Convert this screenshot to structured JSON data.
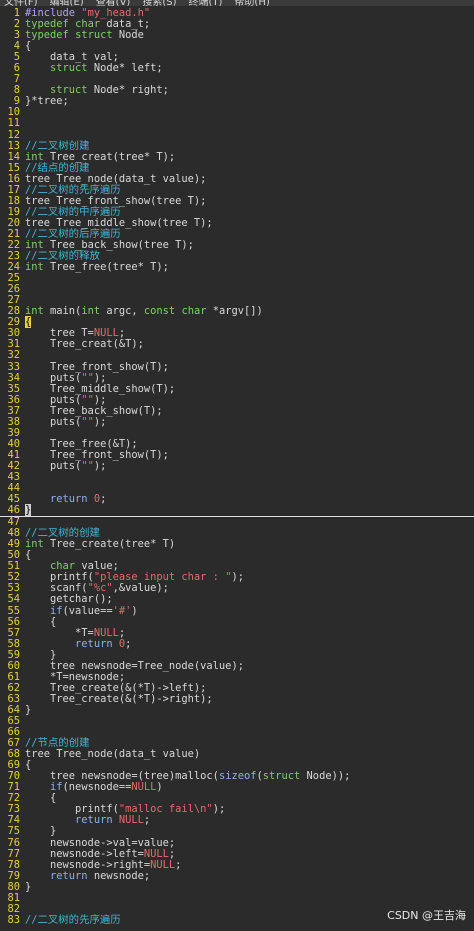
{
  "menu": [
    "文件(F)",
    "编辑(E)",
    "查看(V)",
    "搜索(S)",
    "终端(T)",
    "帮助(H)"
  ],
  "watermark": "CSDN @王吉海",
  "lines": [
    {
      "n": "1",
      "t": "#include \"my_head.h\"",
      "k": "pp"
    },
    {
      "n": "2",
      "t": "typedef char data_t;",
      "k": "ty"
    },
    {
      "n": "3",
      "t": "typedef struct Node",
      "k": "ty"
    },
    {
      "n": "4",
      "t": "{",
      "k": ""
    },
    {
      "n": "5",
      "t": "    data_t val;",
      "k": ""
    },
    {
      "n": "6",
      "t": "    struct Node* left;",
      "k": ""
    },
    {
      "n": "7",
      "t": "",
      "k": ""
    },
    {
      "n": "8",
      "t": "    struct Node* right;",
      "k": ""
    },
    {
      "n": "9",
      "t": "}*tree;",
      "k": ""
    },
    {
      "n": "10",
      "t": "",
      "k": ""
    },
    {
      "n": "11",
      "t": "",
      "k": ""
    },
    {
      "n": "12",
      "t": "",
      "k": ""
    },
    {
      "n": "13",
      "t": "//二叉树创建",
      "k": "cmt"
    },
    {
      "n": "14",
      "t": "int Tree_creat(tree* T);",
      "k": ""
    },
    {
      "n": "15",
      "t": "//结点的创建",
      "k": "cmt"
    },
    {
      "n": "16",
      "t": "tree Tree_node(data_t value);",
      "k": ""
    },
    {
      "n": "17",
      "t": "//二叉树的先序遍历",
      "k": "cmt"
    },
    {
      "n": "18",
      "t": "tree Tree_front_show(tree T);",
      "k": ""
    },
    {
      "n": "19",
      "t": "//二叉树的中序遍历",
      "k": "cmt"
    },
    {
      "n": "20",
      "t": "tree Tree_middle_show(tree T);",
      "k": ""
    },
    {
      "n": "21",
      "t": "//二叉树的后序遍历",
      "k": "cmt"
    },
    {
      "n": "22",
      "t": "int Tree_back_show(tree T);",
      "k": ""
    },
    {
      "n": "23",
      "t": "//二叉树的释放",
      "k": "cmt"
    },
    {
      "n": "24",
      "t": "int Tree_free(tree* T);",
      "k": ""
    },
    {
      "n": "25",
      "t": "",
      "k": ""
    },
    {
      "n": "26",
      "t": "",
      "k": ""
    },
    {
      "n": "27",
      "t": "",
      "k": ""
    },
    {
      "n": "28",
      "t": "int main(int argc, const char *argv[])",
      "k": ""
    },
    {
      "n": "29",
      "t": "{",
      "k": "cur"
    },
    {
      "n": "30",
      "t": "    tree T=NULL;",
      "k": ""
    },
    {
      "n": "31",
      "t": "    Tree_creat(&T);",
      "k": ""
    },
    {
      "n": "32",
      "t": "",
      "k": ""
    },
    {
      "n": "33",
      "t": "    Tree_front_show(T);",
      "k": ""
    },
    {
      "n": "34",
      "t": "    puts(\"\");",
      "k": ""
    },
    {
      "n": "35",
      "t": "    Tree_middle_show(T);",
      "k": ""
    },
    {
      "n": "36",
      "t": "    puts(\"\");",
      "k": ""
    },
    {
      "n": "37",
      "t": "    Tree_back_show(T);",
      "k": ""
    },
    {
      "n": "38",
      "t": "    puts(\"\");",
      "k": ""
    },
    {
      "n": "39",
      "t": "",
      "k": ""
    },
    {
      "n": "40",
      "t": "    Tree_free(&T);",
      "k": ""
    },
    {
      "n": "41",
      "t": "    Tree_front_show(T);",
      "k": ""
    },
    {
      "n": "42",
      "t": "    puts(\"\");",
      "k": ""
    },
    {
      "n": "43",
      "t": "",
      "k": ""
    },
    {
      "n": "44",
      "t": "",
      "k": ""
    },
    {
      "n": "45",
      "t": "    return 0;",
      "k": ""
    },
    {
      "n": "46",
      "t": "}",
      "k": "cur2"
    },
    {
      "n": "47",
      "t": "",
      "k": ""
    },
    {
      "n": "48",
      "t": "//二叉树的创建",
      "k": "cmt"
    },
    {
      "n": "49",
      "t": "int Tree_create(tree* T)",
      "k": ""
    },
    {
      "n": "50",
      "t": "{",
      "k": ""
    },
    {
      "n": "51",
      "t": "    char value;",
      "k": ""
    },
    {
      "n": "52",
      "t": "    printf(\"please input char : \");",
      "k": ""
    },
    {
      "n": "53",
      "t": "    scanf(\"%c\",&value);",
      "k": ""
    },
    {
      "n": "54",
      "t": "    getchar();",
      "k": ""
    },
    {
      "n": "55",
      "t": "    if(value=='#')",
      "k": ""
    },
    {
      "n": "56",
      "t": "    {",
      "k": ""
    },
    {
      "n": "57",
      "t": "        *T=NULL;",
      "k": ""
    },
    {
      "n": "58",
      "t": "        return 0;",
      "k": ""
    },
    {
      "n": "59",
      "t": "    }",
      "k": ""
    },
    {
      "n": "60",
      "t": "    tree newsnode=Tree_node(value);",
      "k": ""
    },
    {
      "n": "61",
      "t": "    *T=newsnode;",
      "k": ""
    },
    {
      "n": "62",
      "t": "    Tree_create(&(*T)->left);",
      "k": ""
    },
    {
      "n": "63",
      "t": "    Tree_create(&(*T)->right);",
      "k": ""
    },
    {
      "n": "64",
      "t": "}",
      "k": ""
    },
    {
      "n": "65",
      "t": "",
      "k": ""
    },
    {
      "n": "66",
      "t": "",
      "k": ""
    },
    {
      "n": "67",
      "t": "//节点的创建",
      "k": "cmt"
    },
    {
      "n": "68",
      "t": "tree Tree_node(data_t value)",
      "k": ""
    },
    {
      "n": "69",
      "t": "{",
      "k": ""
    },
    {
      "n": "70",
      "t": "    tree newsnode=(tree)malloc(sizeof(struct Node));",
      "k": ""
    },
    {
      "n": "71",
      "t": "    if(newsnode==NULL)",
      "k": ""
    },
    {
      "n": "72",
      "t": "    {",
      "k": ""
    },
    {
      "n": "73",
      "t": "        printf(\"malloc fail\\n\");",
      "k": ""
    },
    {
      "n": "74",
      "t": "        return NULL;",
      "k": ""
    },
    {
      "n": "75",
      "t": "    }",
      "k": ""
    },
    {
      "n": "76",
      "t": "    newsnode->val=value;",
      "k": ""
    },
    {
      "n": "77",
      "t": "    newsnode->left=NULL;",
      "k": ""
    },
    {
      "n": "78",
      "t": "    newsnode->right=NULL;",
      "k": ""
    },
    {
      "n": "79",
      "t": "    return newsnode;",
      "k": ""
    },
    {
      "n": "80",
      "t": "}",
      "k": ""
    },
    {
      "n": "81",
      "t": "",
      "k": ""
    },
    {
      "n": "82",
      "t": "",
      "k": ""
    },
    {
      "n": "83",
      "t": "//二叉树的先序遍历",
      "k": "cmt"
    }
  ]
}
